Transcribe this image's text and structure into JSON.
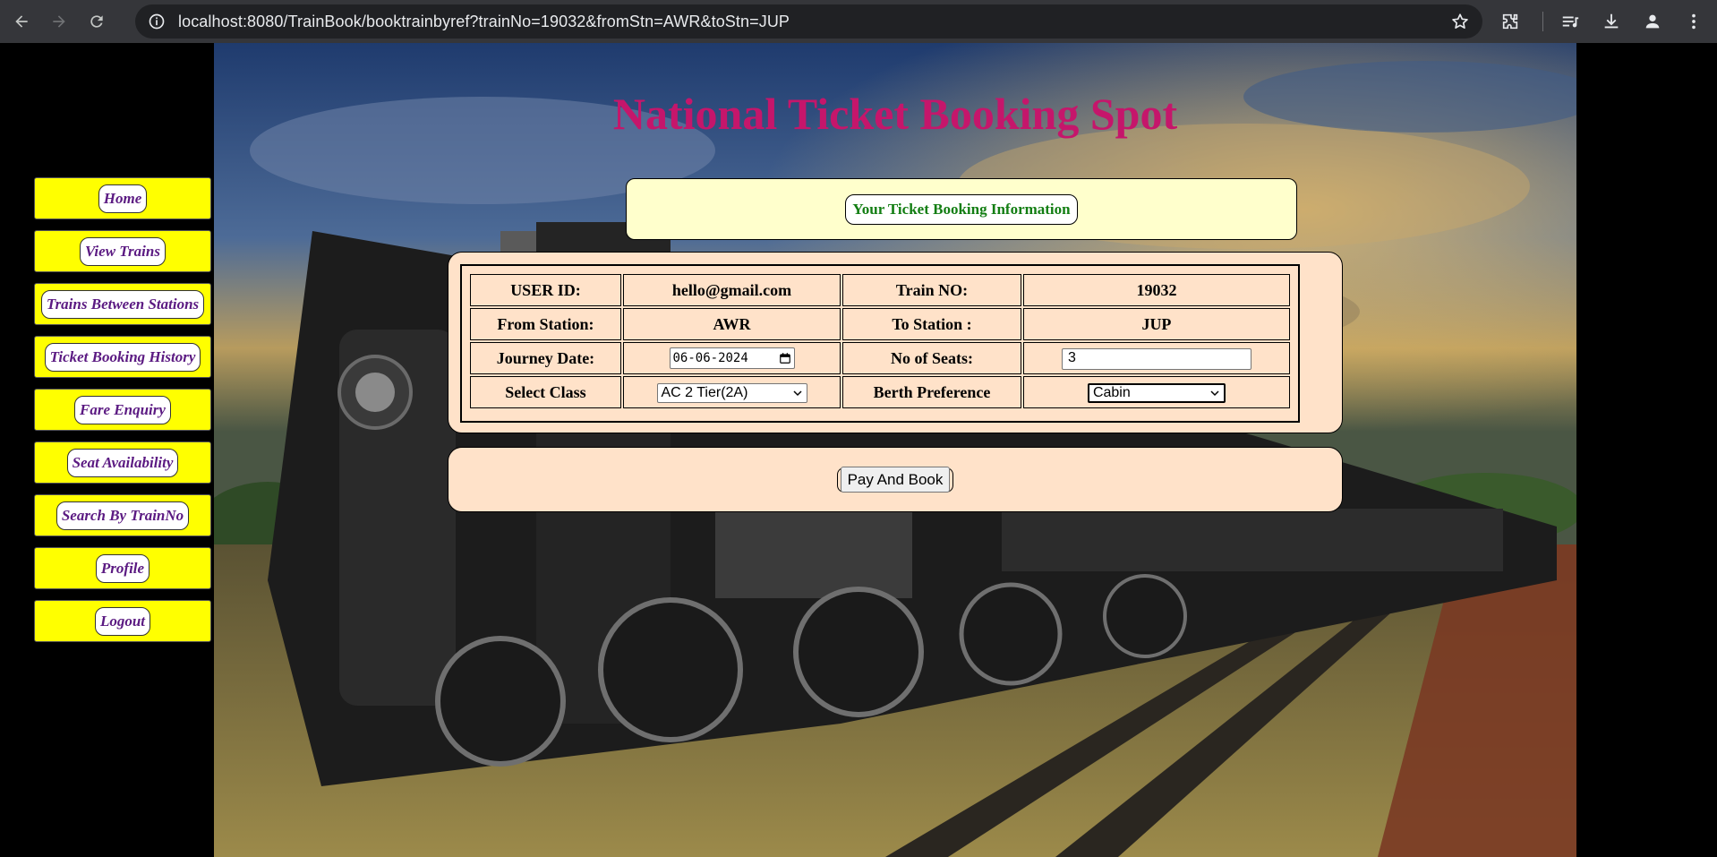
{
  "browser": {
    "url": "localhost:8080/TrainBook/booktrainbyref?trainNo=19032&fromStn=AWR&toStn=JUP"
  },
  "page": {
    "title": "National Ticket Booking Spot"
  },
  "sidebar": {
    "items": [
      {
        "label": "Home"
      },
      {
        "label": "View Trains"
      },
      {
        "label": "Trains Between Stations"
      },
      {
        "label": "Ticket Booking History"
      },
      {
        "label": "Fare Enquiry"
      },
      {
        "label": "Seat Availability"
      },
      {
        "label": "Search By TrainNo"
      },
      {
        "label": "Profile"
      },
      {
        "label": "Logout"
      }
    ]
  },
  "booking": {
    "heading": "Your Ticket Booking Information",
    "user_id_label": "USER ID:",
    "user_id_value": "hello@gmail.com",
    "train_no_label": "Train NO:",
    "train_no_value": "19032",
    "from_label": "From Station:",
    "from_value": "AWR",
    "to_label": "To Station :",
    "to_value": "JUP",
    "date_label": "Journey Date:",
    "date_value": "06-06-2024",
    "seats_label": "No of Seats:",
    "seats_value": "3",
    "class_label": "Select Class",
    "class_value": "AC 2 Tier(2A)",
    "berth_label": "Berth Preference",
    "berth_value": "Cabin",
    "pay_button": "Pay And Book"
  },
  "colors": {
    "title": "#c5166b",
    "sidebar_bg": "#ffff00",
    "sidebar_text": "#5b1a82",
    "heading_text": "#137e13",
    "panel_bg": "#ffe2c9",
    "heading_panel_bg": "#ffffcc"
  }
}
